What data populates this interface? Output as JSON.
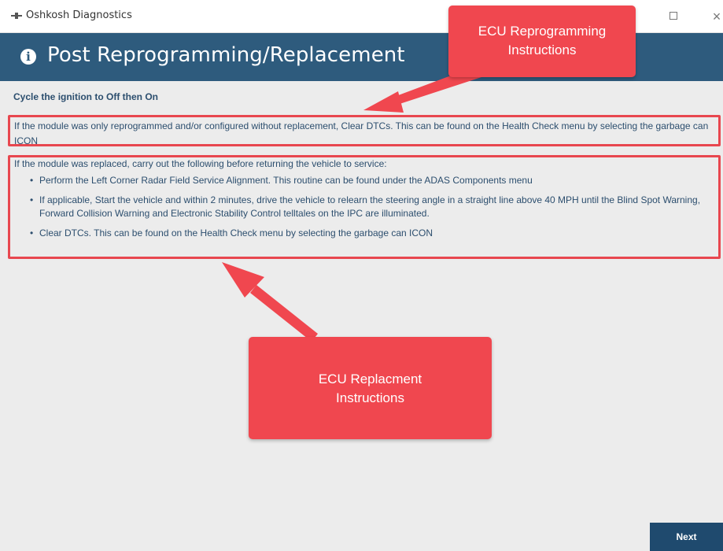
{
  "window": {
    "title": "Oshkosh Diagnostics",
    "maximize_icon": "maximize-icon",
    "close_icon": "close-icon",
    "close_glyph": "×"
  },
  "header": {
    "title": "Post Reprogramming/Replacement",
    "info_icon": "info-icon",
    "info_glyph": "i",
    "background_color": "#2e5b7d"
  },
  "content": {
    "cycle_instruction": "Cycle the ignition to Off then On",
    "reprogrammed_instruction": "If the module was only reprogrammed and/or configured without replacement, Clear DTCs. This can be found on the Health Check menu by selecting the garbage can ICON",
    "replaced_intro": "If the module was replaced, carry out the following before returning the vehicle to service:",
    "replaced_steps": [
      "Perform the Left Corner Radar Field Service Alignment. This routine can be found under the ADAS Components menu",
      "If applicable, Start the vehicle and within 2 minutes, drive the vehicle to relearn the steering angle in a straight line above 40 MPH until the Blind Spot Warning, Forward Collision Warning and Electronic Stability Control telltales on the IPC are illuminated.",
      "Clear DTCs. This can be found on the Health Check menu by selecting the garbage can ICON"
    ]
  },
  "annotations": {
    "reprogramming_callout": "ECU Reprogramming Instructions",
    "replacement_callout": "ECU Replacment Instructions",
    "color": "#f0474f"
  },
  "footer": {
    "next_label": "Next",
    "button_color": "#1f4a6e"
  }
}
